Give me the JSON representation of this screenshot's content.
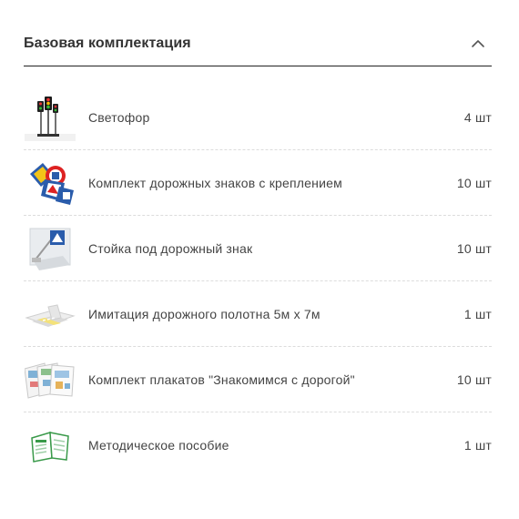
{
  "section": {
    "title": "Базовая комплектация",
    "toggle_icon": "chevron-up-icon"
  },
  "items": [
    {
      "name": "Светофор",
      "qty": "4 шт",
      "icon": "traffic-light-image"
    },
    {
      "name": "Комплект дорожных знаков с креплением",
      "qty": "10 шт",
      "icon": "road-signs-image"
    },
    {
      "name": "Стойка под дорожный знак",
      "qty": "10 шт",
      "icon": "sign-stand-image"
    },
    {
      "name": "Имитация дорожного полотна 5м х 7м",
      "qty": "1 шт",
      "icon": "road-mat-image"
    },
    {
      "name": "Комплект плакатов \"Знакомимся с дорогой\"",
      "qty": "10 шт",
      "icon": "posters-image"
    },
    {
      "name": "Методическое пособие",
      "qty": "1 шт",
      "icon": "manual-book-image"
    }
  ]
}
